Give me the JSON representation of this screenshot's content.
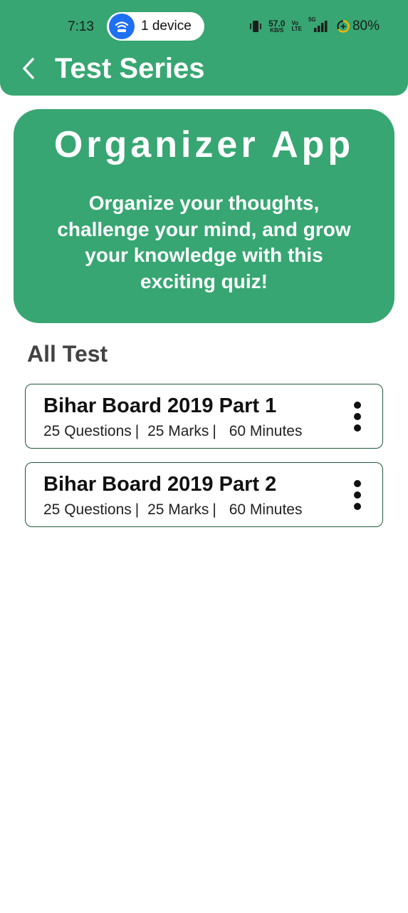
{
  "status_bar": {
    "time": "7:13",
    "hotspot_label": "1 device",
    "net_speed": "57.0",
    "net_speed_unit": "KB/S",
    "volte_top": "Vo",
    "volte_bottom": "LTE",
    "network_type": "5G",
    "battery": "80%"
  },
  "header": {
    "title": "Test Series"
  },
  "banner": {
    "title": "Organizer App",
    "subtitle": "Organize your thoughts, challenge your mind, and grow your knowledge with this exciting quiz!"
  },
  "section": {
    "title": "All Test"
  },
  "tests": [
    {
      "title": "Bihar Board 2019 Part 1",
      "questions": "25 Questions",
      "marks": "25 Marks",
      "minutes": "60 Minutes"
    },
    {
      "title": "Bihar Board 2019 Part 2",
      "questions": "25 Questions",
      "marks": "25 Marks",
      "minutes": "60 Minutes"
    }
  ],
  "separator": "|",
  "colors": {
    "primary": "#37a672",
    "hotspot": "#1e6ff2",
    "card_border": "#1f5a3a",
    "section_text": "#434343"
  }
}
